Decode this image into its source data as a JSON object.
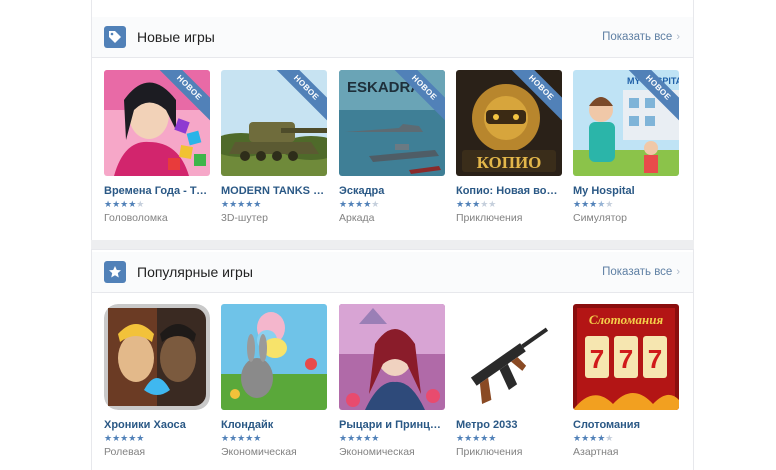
{
  "colors": {
    "accent": "#5181b8",
    "link": "#2a5885",
    "muted": "#828282",
    "star_off": "#c5cfdc"
  },
  "new_games": {
    "title": "Новые игры",
    "icon": "tag-icon",
    "show_all": "Показать все",
    "badge": "НОВОЕ",
    "items": [
      {
        "title": "Времена Года - Три в...",
        "genre": "Головоломка",
        "rating": 4
      },
      {
        "title": "MODERN TANKS BAT...",
        "genre": "3D-шутер",
        "rating": 4.5
      },
      {
        "title": "Эскадра",
        "genre": "Аркада",
        "rating": 4
      },
      {
        "title": "Копио: Новая война",
        "genre": "Приключения",
        "rating": 3
      },
      {
        "title": "My Hospital",
        "genre": "Симулятор",
        "rating": 3.5
      }
    ]
  },
  "popular_games": {
    "title": "Популярные игры",
    "icon": "star-icon",
    "show_all": "Показать все",
    "items": [
      {
        "title": "Хроники Хаоса",
        "genre": "Ролевая",
        "rating": 4.5
      },
      {
        "title": "Клондайк",
        "genre": "Экономическая",
        "rating": 4.5
      },
      {
        "title": "Рыцари и Принцессы",
        "genre": "Экономическая",
        "rating": 4.5
      },
      {
        "title": "Метро 2033",
        "genre": "Приключения",
        "rating": 4.5
      },
      {
        "title": "Слотомания",
        "genre": "Азартная",
        "rating": 4
      }
    ],
    "slot_logo": "Слотомания",
    "slot_digits": "777"
  },
  "game_art_text": {
    "eskadra": "ESKADRA",
    "kopio": "КОПИО",
    "hospital": "MY HOSPITAL"
  }
}
